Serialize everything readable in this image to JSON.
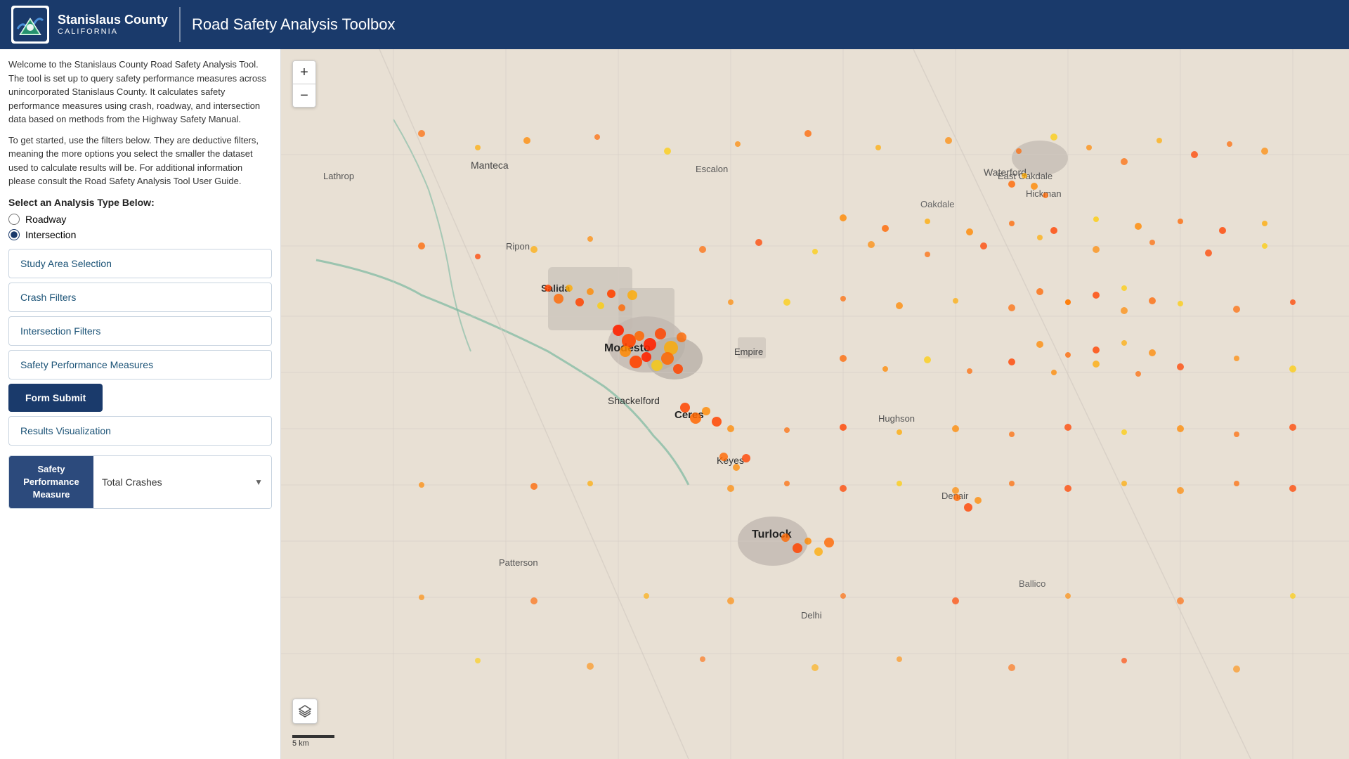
{
  "header": {
    "org_name_main": "Stanislaus County",
    "org_name_sub": "CALIFORNIA",
    "app_title": "Road Safety Analysis Toolbox",
    "logo_alt": "Stanislaus County Logo"
  },
  "sidebar": {
    "welcome_paragraph1": "Welcome to the Stanislaus County Road Safety Analysis Tool. The tool is set up to query safety performance measures across unincorporated Stanislaus County. It calculates safety performance measures using crash, roadway, and intersection data based on methods from the Highway Safety Manual.",
    "welcome_paragraph2": "To get started, use the filters below. They are deductive filters, meaning the more options you select the smaller the dataset used to calculate results will be. For additional information please consult the Road Safety Analysis Tool User Guide.",
    "analysis_type_label": "Select an Analysis Type Below:",
    "radio_options": [
      {
        "id": "roadway",
        "label": "Roadway",
        "checked": false
      },
      {
        "id": "intersection",
        "label": "Intersection",
        "checked": true
      }
    ],
    "accordion_items": [
      {
        "id": "study-area",
        "label": "Study Area Selection"
      },
      {
        "id": "crash-filters",
        "label": "Crash Filters"
      },
      {
        "id": "intersection-filters",
        "label": "Intersection Filters"
      },
      {
        "id": "safety-performance",
        "label": "Safety Performance Measures"
      }
    ],
    "form_submit_label": "Form Submit",
    "results_viz_label": "Results Visualization",
    "spm_widget": {
      "label": "Safety Performance Measure",
      "dropdown_value": "Total Crashes",
      "dropdown_placeholder": "Total Crashes"
    }
  },
  "map": {
    "zoom_in_label": "+",
    "zoom_out_label": "−",
    "scale_label": "5 km",
    "layer_icon": "layers"
  },
  "colors": {
    "header_bg": "#1a3a6b",
    "accent": "#1a5276",
    "btn_primary": "#1a3a6b",
    "spm_label_bg": "#2c4a7c"
  }
}
